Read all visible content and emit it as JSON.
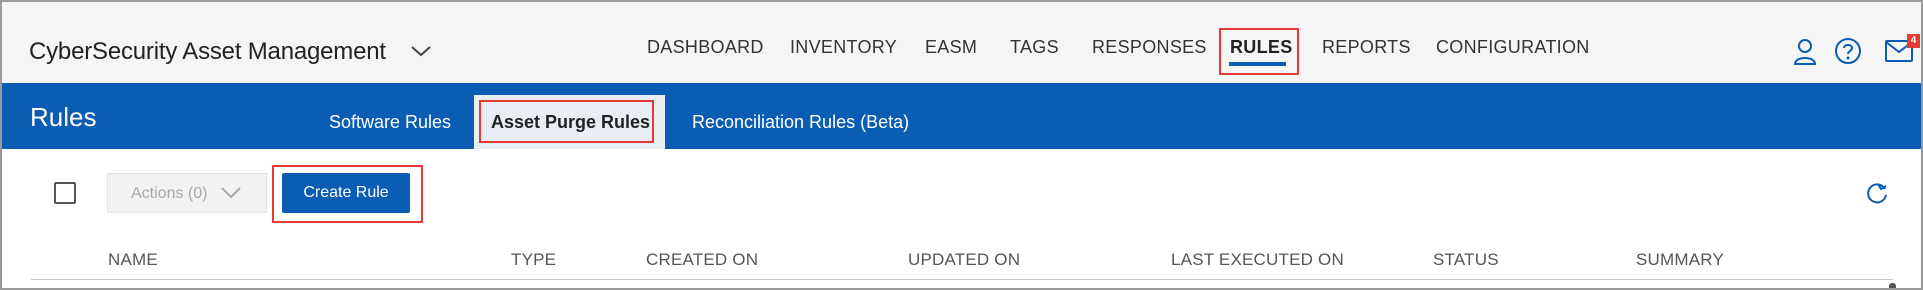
{
  "header": {
    "app_title": "CyberSecurity Asset Management",
    "app_switcher_icon": "chevron-down-icon",
    "nav": [
      {
        "label": "DASHBOARD",
        "active": false
      },
      {
        "label": "INVENTORY",
        "active": false
      },
      {
        "label": "EASM",
        "active": false
      },
      {
        "label": "TAGS",
        "active": false
      },
      {
        "label": "RESPONSES",
        "active": false
      },
      {
        "label": "RULES",
        "active": true
      },
      {
        "label": "REPORTS",
        "active": false
      },
      {
        "label": "CONFIGURATION",
        "active": false
      }
    ],
    "icons": [
      "user-icon",
      "help-icon",
      "mail-icon"
    ],
    "mail_badge": "4"
  },
  "subheader": {
    "page_title": "Rules",
    "tabs": [
      {
        "label": "Software Rules",
        "active": false
      },
      {
        "label": "Asset Purge Rules",
        "active": true
      },
      {
        "label": "Reconciliation Rules (Beta)",
        "active": false
      }
    ]
  },
  "toolbar": {
    "actions_label": "Actions (0)",
    "create_label": "Create Rule",
    "refresh_icon": "refresh-icon"
  },
  "table": {
    "columns": [
      "NAME",
      "TYPE",
      "CREATED ON",
      "UPDATED ON",
      "LAST EXECUTED ON",
      "STATUS",
      "SUMMARY"
    ]
  },
  "colors": {
    "primary": "#0b5cb4",
    "highlight": "#e53935",
    "header_bg": "#f5f5f5"
  }
}
